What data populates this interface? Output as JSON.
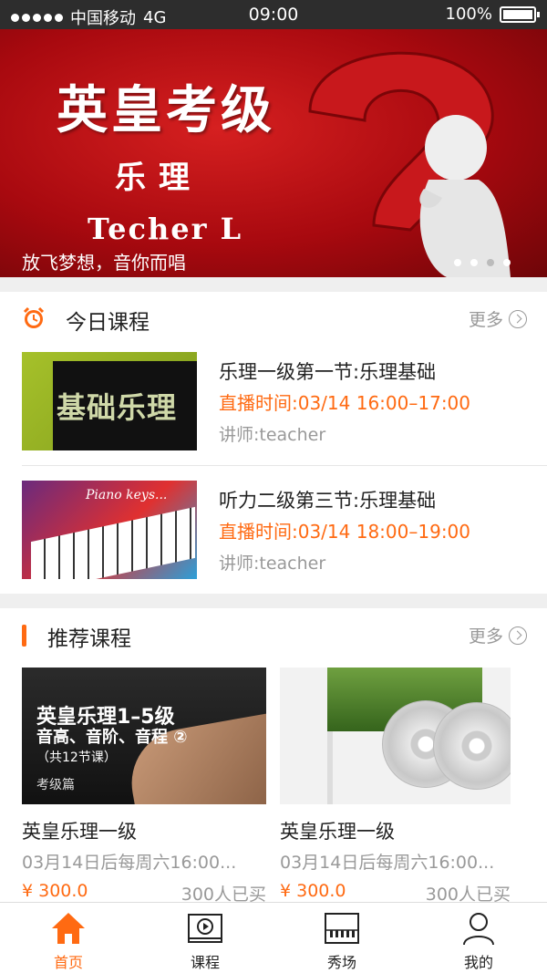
{
  "status_bar": {
    "carrier": "中国移动",
    "network": "4G",
    "time": "09:00",
    "battery": "100%"
  },
  "banner": {
    "title": "英皇考级",
    "subtitle": "乐理",
    "teacher": "Techer L",
    "caption": "放飞梦想，音你而唱",
    "active_index": 2,
    "slide_count": 4
  },
  "today": {
    "title": "今日课程",
    "more": "更多",
    "icon": "alarm-clock-icon",
    "courses": [
      {
        "name": "乐理一级第一节:乐理基础",
        "time": "直播时间:03/14 16:00–17:00",
        "lecturer": "讲师:teacher",
        "thumb_text": "基础乐理"
      },
      {
        "name": "听力二级第三节:乐理基础",
        "time": "直播时间:03/14 18:00–19:00",
        "lecturer": "讲师:teacher",
        "thumb_text": "Piano keys..."
      }
    ]
  },
  "recommend": {
    "title": "推荐课程",
    "more": "更多",
    "courses": [
      {
        "name": "英皇乐理一级",
        "schedule": "03月14日后每周六16:00...",
        "price": "¥ 300.0",
        "buyers": "300人已买",
        "img_line1": "英皇乐理1–5级",
        "img_line2": "音高、音阶、音程 ②",
        "img_line3": "（共12节课）",
        "img_line4": "考级篇"
      },
      {
        "name": "英皇乐理一级",
        "schedule": "03月14日后每周六16:00...",
        "price": "¥ 300.0",
        "buyers": "300人已买"
      }
    ]
  },
  "tabs": [
    {
      "label": "首页",
      "icon": "home-icon",
      "active": true
    },
    {
      "label": "课程",
      "icon": "play-video-icon",
      "active": false
    },
    {
      "label": "秀场",
      "icon": "piano-icon",
      "active": false
    },
    {
      "label": "我的",
      "icon": "user-icon",
      "active": false
    }
  ],
  "colors": {
    "accent": "#ff6a12",
    "status_bar": "#2d2d2d",
    "banner_red": "#b50d12",
    "muted_text": "#999999"
  }
}
